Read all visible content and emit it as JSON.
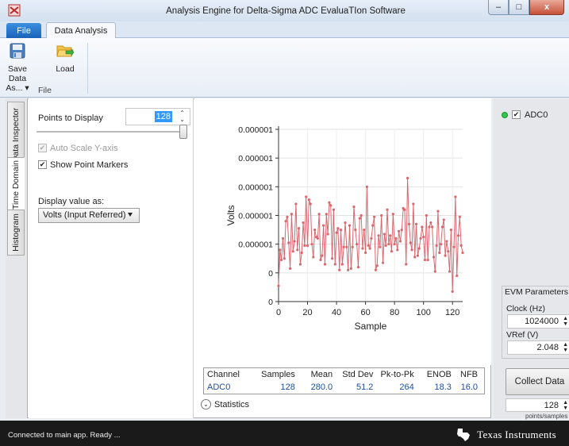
{
  "window": {
    "title": "Analysis Engine for Delta-Sigma ADC EvaluaTIon Software",
    "minimize": "–",
    "maximize": "□",
    "close": "x"
  },
  "ribbon": {
    "tabs": [
      "File",
      "Data Analysis"
    ],
    "save_label": "Save Data As... ▾",
    "load_label": "Load",
    "group_label": "File"
  },
  "side_tabs": [
    "Data Inspector",
    "Time Domain",
    "Histogram"
  ],
  "controls": {
    "points_label": "Points to Display",
    "points_value": "128",
    "slider_level": 1.0,
    "auto_scale_label": "Auto Scale Y-axis",
    "auto_scale_checked": true,
    "auto_scale_enabled": false,
    "show_markers_label": "Show Point Markers",
    "show_markers_checked": true,
    "display_label": "Display value as:",
    "display_value": "Volts (Input Referred)"
  },
  "chart_data": {
    "type": "line",
    "xlabel": "Sample",
    "ylabel": "Volts",
    "xticks": [
      0,
      20,
      40,
      60,
      80,
      100,
      120
    ],
    "yticklabels": [
      "0",
      "0",
      "0.000001",
      "0.000001",
      "0.000001",
      "0.000001",
      "0.000001"
    ],
    "xlim": [
      0,
      127
    ],
    "ylim": [
      0,
      6
    ],
    "marker": "point",
    "color": "#d9686e",
    "series": [
      {
        "values": [
          0.55,
          1.8,
          1.45,
          2.2,
          1.5,
          2.8,
          2.95,
          2.05,
          1.15,
          3.05,
          1.75,
          2.1,
          3.4,
          1.8,
          2.55,
          1.3,
          1.7,
          2.75,
          1.95,
          3.65,
          1.95,
          3.55,
          3.4,
          2.0,
          1.55,
          2.5,
          2.25,
          2.2,
          3.05,
          1.45,
          1.6,
          2.65,
          1.3,
          3.05,
          2.35,
          3.45,
          3.35,
          1.5,
          3.2,
          1.3,
          2.4,
          2.55,
          1.1,
          2.5,
          1.3,
          1.9,
          2.75,
          1.9,
          1.1,
          2.65,
          1.15,
          1.9,
          3.3,
          2.5,
          2.0,
          1.2,
          2.9,
          3.0,
          1.85,
          2.5,
          1.7,
          4.0,
          1.95,
          1.85,
          2.2,
          2.65,
          2.95,
          1.1,
          1.25,
          2.3,
          1.9,
          3.0,
          1.35,
          2.35,
          1.95,
          3.2,
          2.0,
          2.3,
          1.75,
          3.05,
          2.0,
          2.2,
          1.8,
          2.45,
          2.1,
          2.5,
          3.25,
          3.2,
          1.3,
          4.3,
          2.7,
          2.05,
          1.8,
          3.4,
          1.55,
          2.7,
          1.6,
          1.85,
          2.2,
          2.6,
          2.25,
          1.45,
          3.0,
          1.45,
          2.6,
          2.75,
          2.6,
          1.55,
          1.05,
          1.95,
          3.15,
          1.7,
          2.0,
          2.6,
          2.85,
          1.6,
          2.1,
          1.75,
          1.05,
          2.5,
          0.35,
          1.9,
          3.65,
          0.9,
          2.3,
          2.95,
          1.95,
          1.7
        ]
      }
    ]
  },
  "statistics": {
    "headers": [
      "Channel",
      "Samples",
      "Mean",
      "Std Dev",
      "Pk-to-Pk",
      "ENOB",
      "NFB"
    ],
    "rows": [
      [
        "ADC0",
        "128",
        "280.0",
        "51.2",
        "264",
        "18.3",
        "16.0"
      ]
    ],
    "toggle_label": "Statistics"
  },
  "right_panel": {
    "channel_name": "ADC0",
    "channel_checked": true,
    "status_color": "#2ec94a",
    "evm_title": "EVM Parameters",
    "clock_label": "Clock (Hz)",
    "clock_value": "1024000",
    "vref_label": "VRef (V)",
    "vref_value": "2.048",
    "collect_label": "Collect Data",
    "points_value": "128",
    "points_caption": "points/samples"
  },
  "status": {
    "text": "Connected to main app.  Ready ...",
    "brand": "Texas Instruments"
  }
}
